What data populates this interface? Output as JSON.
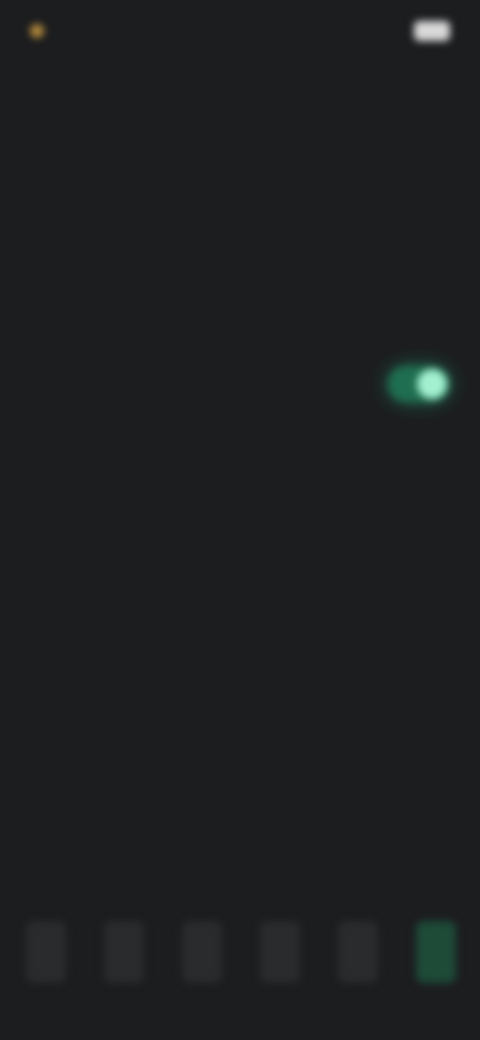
{
  "status_bar": {
    "left_text": "",
    "right_text": ""
  },
  "rows": {
    "top_setting": {
      "label": "",
      "value": ""
    },
    "section_1": {
      "header": ""
    },
    "setting_1": {
      "label": ""
    },
    "setting_2": {
      "label": "",
      "toggle_on": true
    },
    "section_2_setting": {
      "label": ""
    },
    "setting_3": {
      "label": "",
      "value": ""
    },
    "setting_4": {
      "label": ""
    },
    "setting_5": {
      "label": ""
    },
    "section_3": {
      "header": ""
    },
    "caption": {
      "line_1": "",
      "line_2": ""
    }
  },
  "tabs": [
    {
      "label": ""
    },
    {
      "label": ""
    },
    {
      "label": ""
    },
    {
      "label": ""
    },
    {
      "label": ""
    },
    {
      "label": ""
    }
  ],
  "colors": {
    "background": "#1c1d1f",
    "accent_green": "#2f9b6d",
    "toggle_track": "#1f6e51",
    "toggle_knob": "#a2f0d0"
  }
}
